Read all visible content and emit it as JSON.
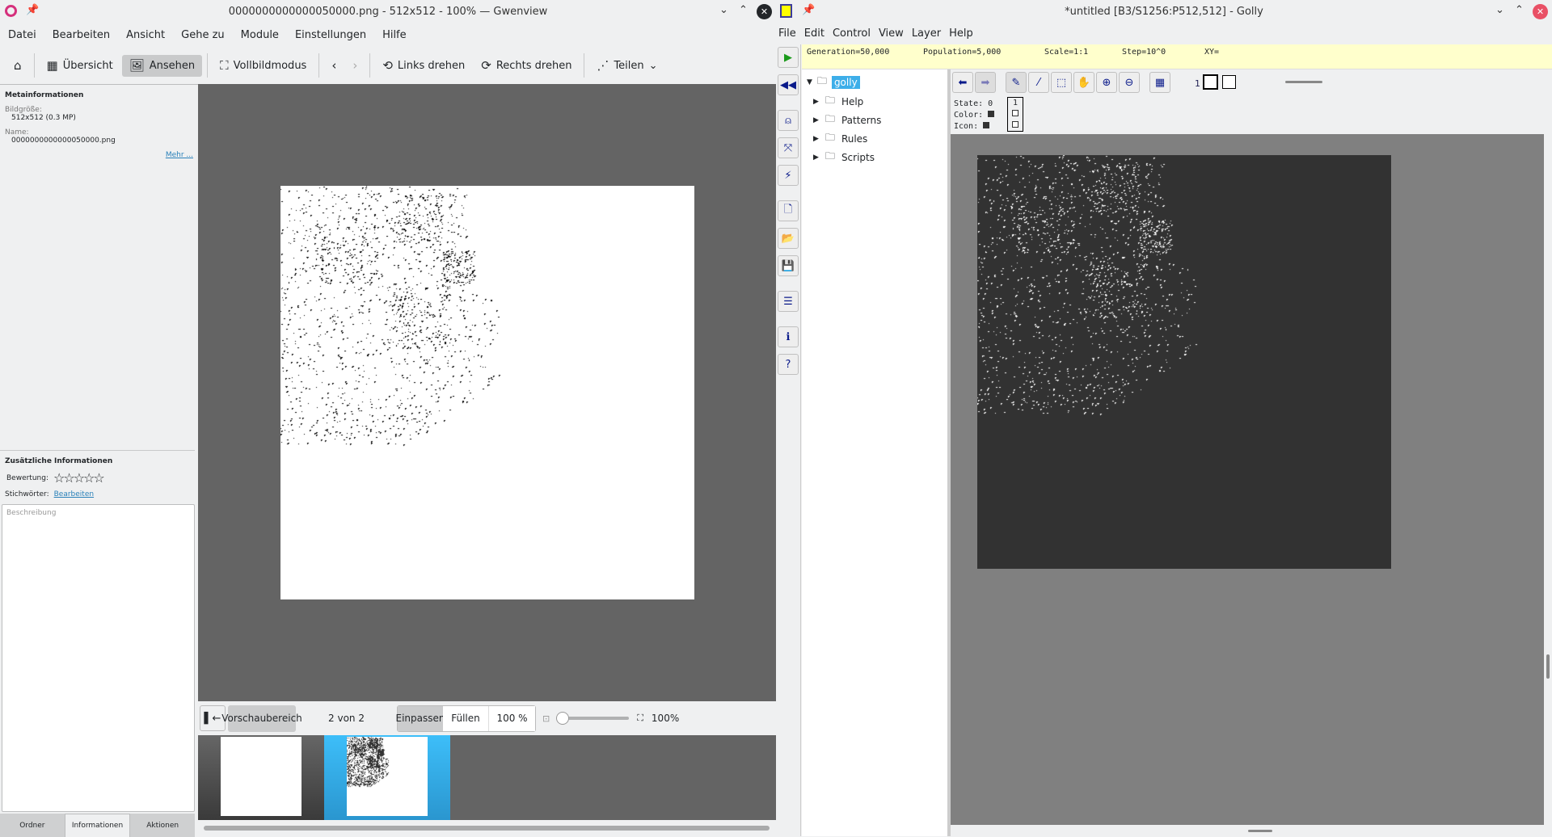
{
  "gwenview": {
    "title": "0000000000000050000.png - 512x512 - 100% — Gwenview",
    "menu": [
      "Datei",
      "Bearbeiten",
      "Ansicht",
      "Gehe zu",
      "Module",
      "Einstellungen",
      "Hilfe"
    ],
    "toolbar": {
      "overview": "Übersicht",
      "view": "Ansehen",
      "fullscreen": "Vollbildmodus",
      "rotate_left": "Links drehen",
      "rotate_right": "Rechts drehen",
      "share": "Teilen"
    },
    "meta": {
      "heading": "Metainformationen",
      "size_label": "Bildgröße:",
      "size_value": "512x512 (0.3 MP)",
      "name_label": "Name:",
      "name_value": "0000000000000050000.png",
      "more": "Mehr ..."
    },
    "extra": {
      "heading": "Zusätzliche Informationen",
      "rating_label": "Bewertung:",
      "rating": 0,
      "tags_label": "Stichwörter:",
      "tags_edit": "Bearbeiten",
      "description_placeholder": "Beschreibung"
    },
    "sidebar_tabs": [
      "Ordner",
      "Informationen",
      "Aktionen"
    ],
    "bottom": {
      "preview": "Vorschaubereich",
      "counter": "2 von 2",
      "fit": "Einpassen",
      "fill": "Füllen",
      "zoom_100": "100 %",
      "zoom_value": "100%"
    }
  },
  "golly": {
    "title": "*untitled [B3/S1256:P512,512] - Golly",
    "menu": [
      "File",
      "Edit",
      "Control",
      "View",
      "Layer",
      "Help"
    ],
    "status": {
      "generation": "Generation=50,000",
      "population": "Population=5,000",
      "scale": "Scale=1:1",
      "step": "Step=10^0",
      "xy": "XY="
    },
    "tree": {
      "root": "golly",
      "children": [
        "Help",
        "Patterns",
        "Rules",
        "Scripts"
      ]
    },
    "state": {
      "state_label": "State:",
      "color_label": "Color:",
      "icon_label": "Icon:",
      "state0": "0",
      "state1": "1",
      "current": "1"
    }
  }
}
